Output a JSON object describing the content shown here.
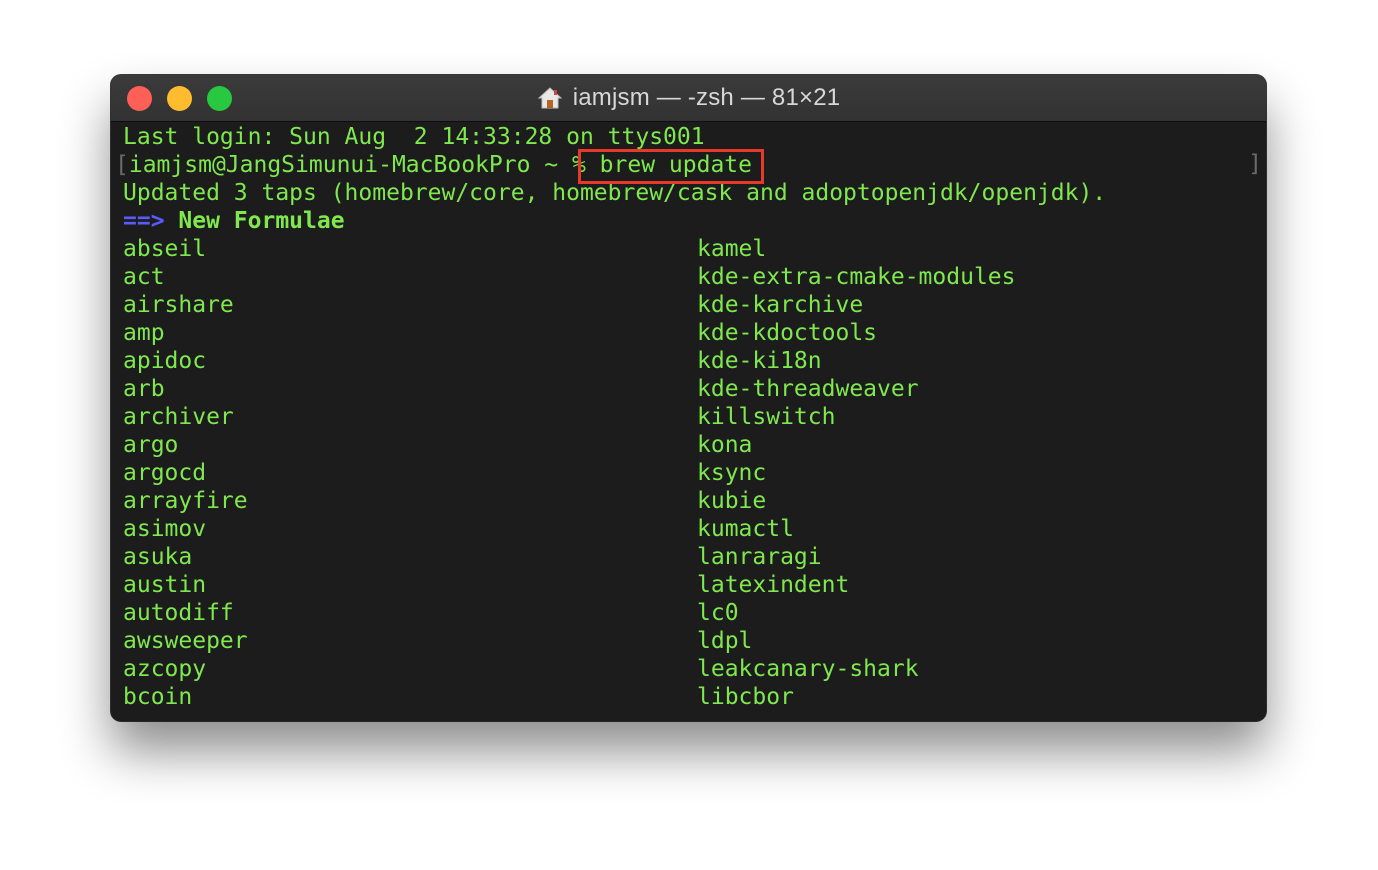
{
  "window": {
    "title": "iamjsm — -zsh — 81×21",
    "title_icon": "home-icon"
  },
  "terminal": {
    "last_login": "Last login: Sun Aug  2 14:33:28 on ttys001",
    "prompt_bracket_left": "[",
    "prompt": "iamjsm@JangSimunui-MacBookPro ~ % ",
    "command": "brew update",
    "prompt_bracket_right": "]",
    "updated": "Updated 3 taps (homebrew/core, homebrew/cask and adoptopenjdk/openjdk).",
    "section_arrow": "==>",
    "section_title": "New Formulae",
    "formulae_left": [
      "abseil",
      "act",
      "airshare",
      "amp",
      "apidoc",
      "arb",
      "archiver",
      "argo",
      "argocd",
      "arrayfire",
      "asimov",
      "asuka",
      "austin",
      "autodiff",
      "awsweeper",
      "azcopy",
      "bcoin"
    ],
    "formulae_right": [
      "kamel",
      "kde-extra-cmake-modules",
      "kde-karchive",
      "kde-kdoctools",
      "kde-ki18n",
      "kde-threadweaver",
      "killswitch",
      "kona",
      "ksync",
      "kubie",
      "kumactl",
      "lanraragi",
      "latexindent",
      "lc0",
      "ldpl",
      "leakcanary-shark",
      "libcbor"
    ]
  },
  "colors": {
    "text": "#7fe84e",
    "arrow": "#5a5bff",
    "highlight": "#e53a2a",
    "background": "#1c1c1c"
  }
}
